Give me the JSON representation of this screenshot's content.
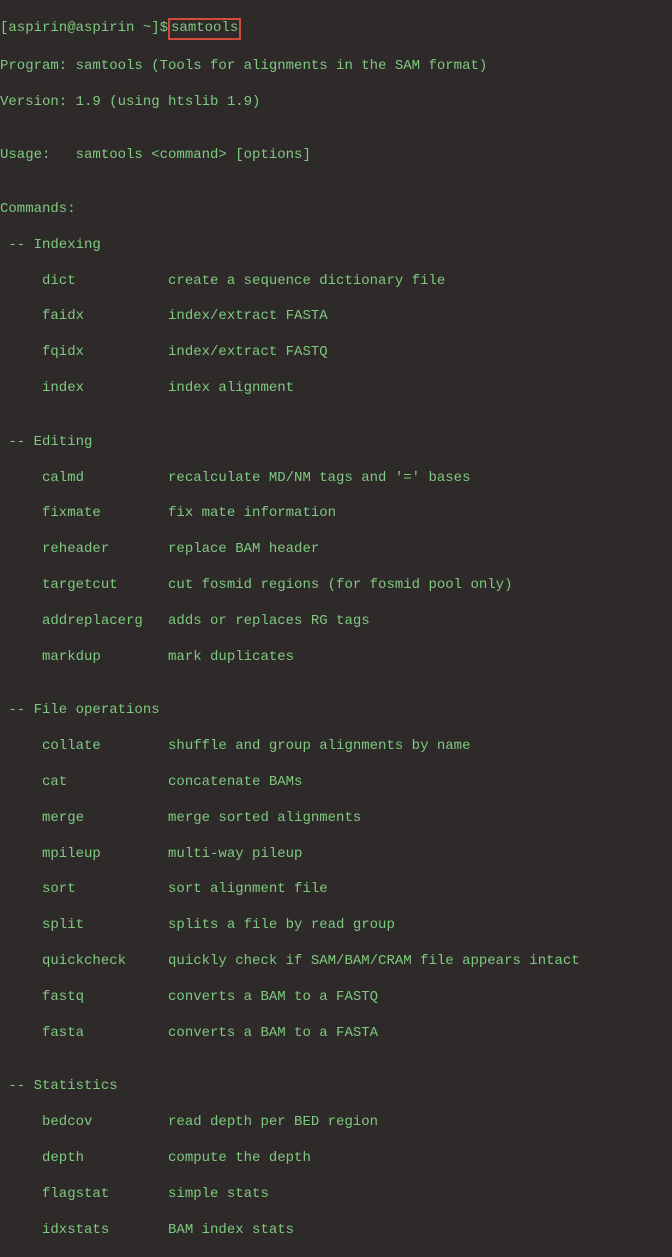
{
  "prompt": "[aspirin@aspirin ~]$",
  "command": " samtools ",
  "blank": "",
  "program_line": "Program: samtools (Tools for alignments in the SAM format)",
  "version_line": "Version: 1.9 (using htslib 1.9)",
  "usage_line": "Usage:   samtools <command> [options]",
  "commands_label": "Commands:",
  "sections": {
    "indexing": {
      "header": " -- Indexing",
      "dict": "     dict           create a sequence dictionary file",
      "faidx": "     faidx          index/extract FASTA",
      "fqidx": "     fqidx          index/extract FASTQ",
      "index": "     index          index alignment"
    },
    "editing": {
      "header": " -- Editing",
      "calmd": "     calmd          recalculate MD/NM tags and '=' bases",
      "fixmate": "     fixmate        fix mate information",
      "reheader": "     reheader       replace BAM header",
      "targetcut": "     targetcut      cut fosmid regions (for fosmid pool only)",
      "addreplacerg": "     addreplacerg   adds or replaces RG tags",
      "markdup": "     markdup        mark duplicates"
    },
    "fileops": {
      "header": " -- File operations",
      "collate": "     collate        shuffle and group alignments by name",
      "cat": "     cat            concatenate BAMs",
      "merge": "     merge          merge sorted alignments",
      "mpileup": "     mpileup        multi-way pileup",
      "sort": "     sort           sort alignment file",
      "split": "     split          splits a file by read group",
      "quickcheck": "     quickcheck     quickly check if SAM/BAM/CRAM file appears intact",
      "fastq": "     fastq          converts a BAM to a FASTQ",
      "fasta": "     fasta          converts a BAM to a FASTA"
    },
    "statistics": {
      "header": " -- Statistics",
      "bedcov": "     bedcov         read depth per BED region",
      "depth": "     depth          compute the depth",
      "flagstat": "     flagstat       simple stats",
      "idxstats": "     idxstats       BAM index stats"
    }
  }
}
